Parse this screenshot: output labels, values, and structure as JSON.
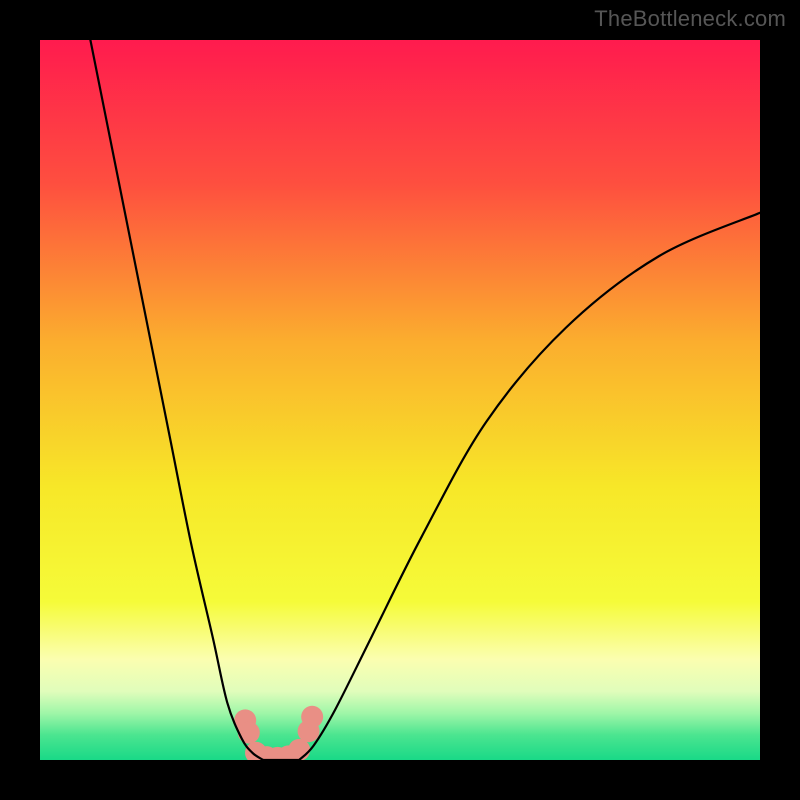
{
  "watermark": "TheBottleneck.com",
  "chart_data": {
    "type": "line",
    "title": "",
    "xlabel": "",
    "ylabel": "",
    "xlim": [
      0,
      100
    ],
    "ylim": [
      0,
      100
    ],
    "series": [
      {
        "name": "left-curve",
        "x": [
          7,
          10,
          14,
          18,
          21,
          24,
          26,
          28,
          29.5,
          31
        ],
        "y": [
          100,
          85,
          65,
          45,
          30,
          17,
          8,
          3,
          1,
          0
        ]
      },
      {
        "name": "right-curve",
        "x": [
          36,
          38,
          41,
          46,
          53,
          62,
          73,
          86,
          100
        ],
        "y": [
          0,
          2,
          7,
          17,
          31,
          47,
          60,
          70,
          76
        ]
      },
      {
        "name": "floor",
        "x": [
          31,
          32,
          34,
          36
        ],
        "y": [
          0,
          0,
          0,
          0
        ]
      }
    ],
    "markers": {
      "name": "salmon-dots",
      "color": "#E98F85",
      "points": [
        {
          "x": 28.5,
          "y": 5.5
        },
        {
          "x": 29.0,
          "y": 3.8
        },
        {
          "x": 30.0,
          "y": 1.0
        },
        {
          "x": 31.5,
          "y": 0.4
        },
        {
          "x": 33.0,
          "y": 0.3
        },
        {
          "x": 34.5,
          "y": 0.5
        },
        {
          "x": 36.0,
          "y": 1.4
        },
        {
          "x": 37.3,
          "y": 4.0
        },
        {
          "x": 37.8,
          "y": 6.0
        }
      ]
    },
    "gradient_stops": [
      {
        "offset": 0.0,
        "color": "#FF1B4E"
      },
      {
        "offset": 0.2,
        "color": "#FE4F3F"
      },
      {
        "offset": 0.42,
        "color": "#FBAE2E"
      },
      {
        "offset": 0.62,
        "color": "#F7E728"
      },
      {
        "offset": 0.78,
        "color": "#F5FB39"
      },
      {
        "offset": 0.86,
        "color": "#FBFEB0"
      },
      {
        "offset": 0.905,
        "color": "#E0FDBB"
      },
      {
        "offset": 0.935,
        "color": "#9FF6A8"
      },
      {
        "offset": 0.965,
        "color": "#4CE590"
      },
      {
        "offset": 1.0,
        "color": "#19D987"
      }
    ]
  }
}
